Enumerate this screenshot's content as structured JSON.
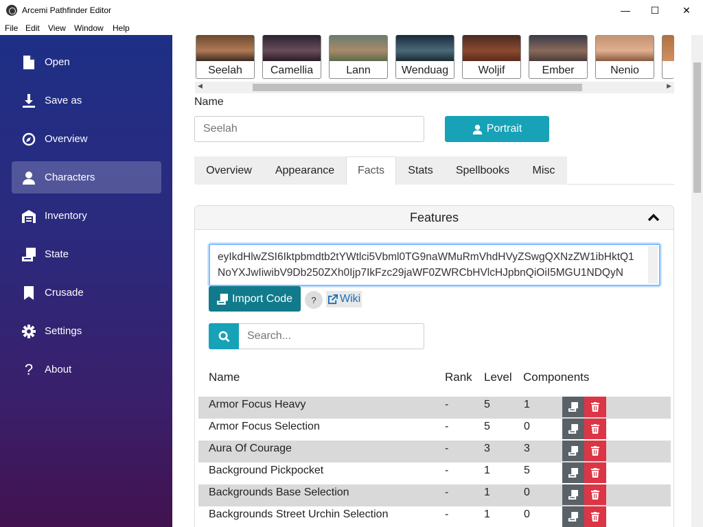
{
  "window": {
    "title": "Arcemi Pathfinder Editor",
    "minimize": "—",
    "maximize": "☐",
    "close": "✕"
  },
  "menu": [
    "File",
    "Edit",
    "View",
    "Window",
    "Help"
  ],
  "sidebar": {
    "items": [
      {
        "label": "Open",
        "icon": "file-icon"
      },
      {
        "label": "Save as",
        "icon": "download-icon"
      },
      {
        "label": "Overview",
        "icon": "compass-icon"
      },
      {
        "label": "Characters",
        "icon": "user-icon",
        "active": true
      },
      {
        "label": "Inventory",
        "icon": "warehouse-icon"
      },
      {
        "label": "State",
        "icon": "scroll-icon"
      },
      {
        "label": "Crusade",
        "icon": "bookmark-icon"
      },
      {
        "label": "Settings",
        "icon": "gear-icon"
      },
      {
        "label": "About",
        "icon": "question-icon"
      }
    ]
  },
  "portraits": [
    "Seelah",
    "Camellia",
    "Lann",
    "Wenduag",
    "Woljif",
    "Ember",
    "Nenio"
  ],
  "name_field": {
    "label": "Name",
    "placeholder": "Seelah"
  },
  "portrait_button": "Portrait",
  "tabs": [
    "Overview",
    "Appearance",
    "Facts",
    "Stats",
    "Spellbooks",
    "Misc"
  ],
  "active_tab": "Facts",
  "features": {
    "title": "Features",
    "code": "eyIkdHlwZSI6Iktpbmdtb2tYWtlci5Vbml0TG9naWMuRmVhdHVyZSwgQXNzZW1ibHktQ1NoYXJwIiwibV9Db250ZXh0Ijp7IkFzc29jaWF0ZWRCbHVlcHJpbnQiOiI5MGU1NDQyN",
    "import_label": "Import Code",
    "help_label": "?",
    "wiki_label": "Wiki",
    "search_placeholder": "Search...",
    "columns": [
      "Name",
      "Rank",
      "Level",
      "Components"
    ],
    "rows": [
      {
        "name": "Armor Focus Heavy",
        "rank": "-",
        "level": "5",
        "components": "1"
      },
      {
        "name": "Armor Focus Selection",
        "rank": "-",
        "level": "5",
        "components": "0"
      },
      {
        "name": "Aura Of Courage",
        "rank": "-",
        "level": "3",
        "components": "3"
      },
      {
        "name": "Background Pickpocket",
        "rank": "-",
        "level": "1",
        "components": "5"
      },
      {
        "name": "Backgrounds Base Selection",
        "rank": "-",
        "level": "1",
        "components": "0"
      },
      {
        "name": "Backgrounds Street Urchin Selection",
        "rank": "-",
        "level": "1",
        "components": "0"
      }
    ]
  },
  "colors": {
    "accent": "#17a2b8",
    "import": "#117a8b",
    "danger": "#dc3545",
    "secondary": "#5a6268"
  }
}
